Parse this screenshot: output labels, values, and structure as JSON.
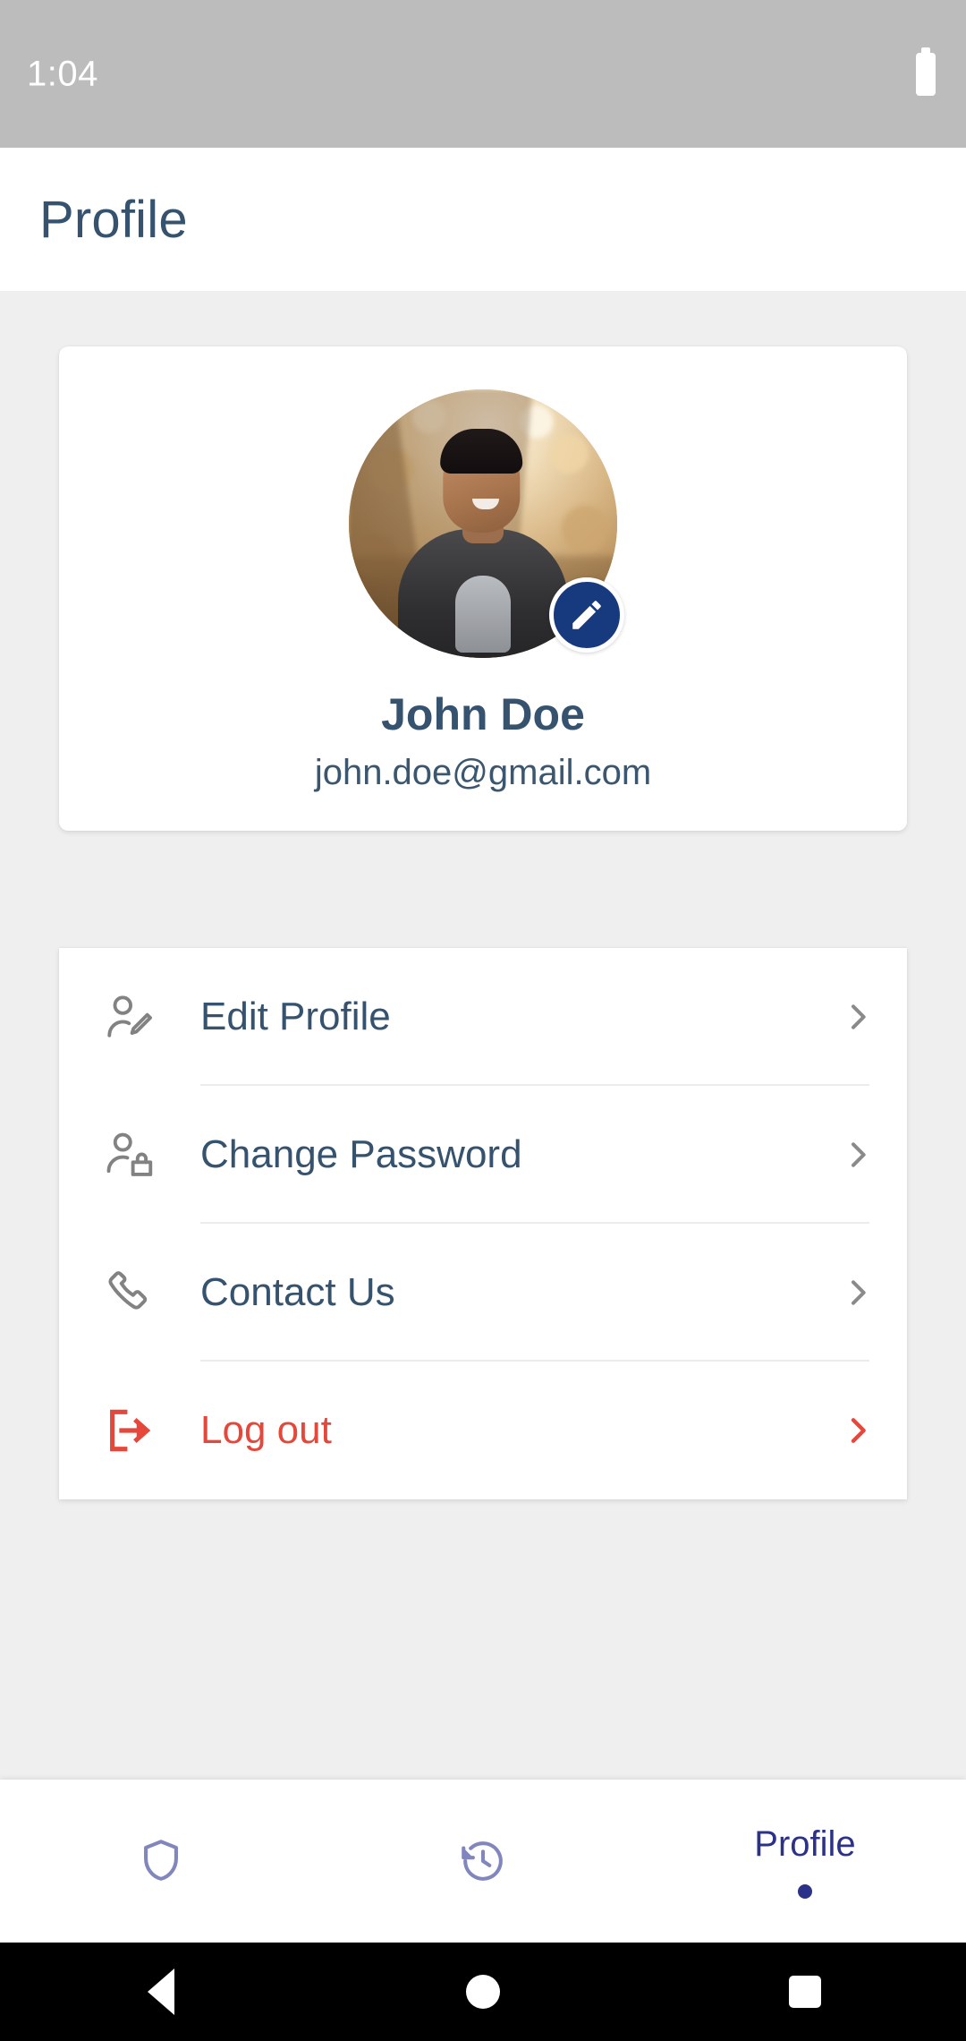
{
  "status_bar": {
    "time": "1:04",
    "battery_icon": "battery-icon"
  },
  "app_bar": {
    "title": "Profile"
  },
  "profile_card": {
    "avatar_icon": "user-avatar-photo",
    "edit_avatar_icon": "pencil-icon",
    "name": "John Doe",
    "email": "john.doe@gmail.com",
    "accent_color": "#173a7e",
    "text_color": "#35526e"
  },
  "menu": {
    "items": [
      {
        "id": "edit-profile",
        "label": "Edit Profile",
        "icon": "user-edit-icon",
        "chevron": "chevron-right-icon",
        "danger": false
      },
      {
        "id": "change-password",
        "label": "Change Password",
        "icon": "user-lock-icon",
        "chevron": "chevron-right-icon",
        "danger": false
      },
      {
        "id": "contact-us",
        "label": "Contact Us",
        "icon": "phone-icon",
        "chevron": "chevron-right-icon",
        "danger": false
      },
      {
        "id": "log-out",
        "label": "Log out",
        "icon": "logout-icon",
        "chevron": "chevron-right-icon",
        "danger": true
      }
    ],
    "icon_color": "#828282",
    "danger_color": "#e5483a"
  },
  "bottom_nav": {
    "items": [
      {
        "id": "security",
        "label": "",
        "icon": "shield-icon",
        "active": false
      },
      {
        "id": "history",
        "label": "",
        "icon": "history-icon",
        "active": false
      },
      {
        "id": "profile",
        "label": "Profile",
        "icon": "",
        "active": true
      }
    ],
    "inactive_color": "#8186bd",
    "active_color": "#2b3288"
  },
  "system_nav": {
    "back_icon": "triangle-back-icon",
    "home_icon": "circle-home-icon",
    "recents_icon": "square-recents-icon"
  }
}
